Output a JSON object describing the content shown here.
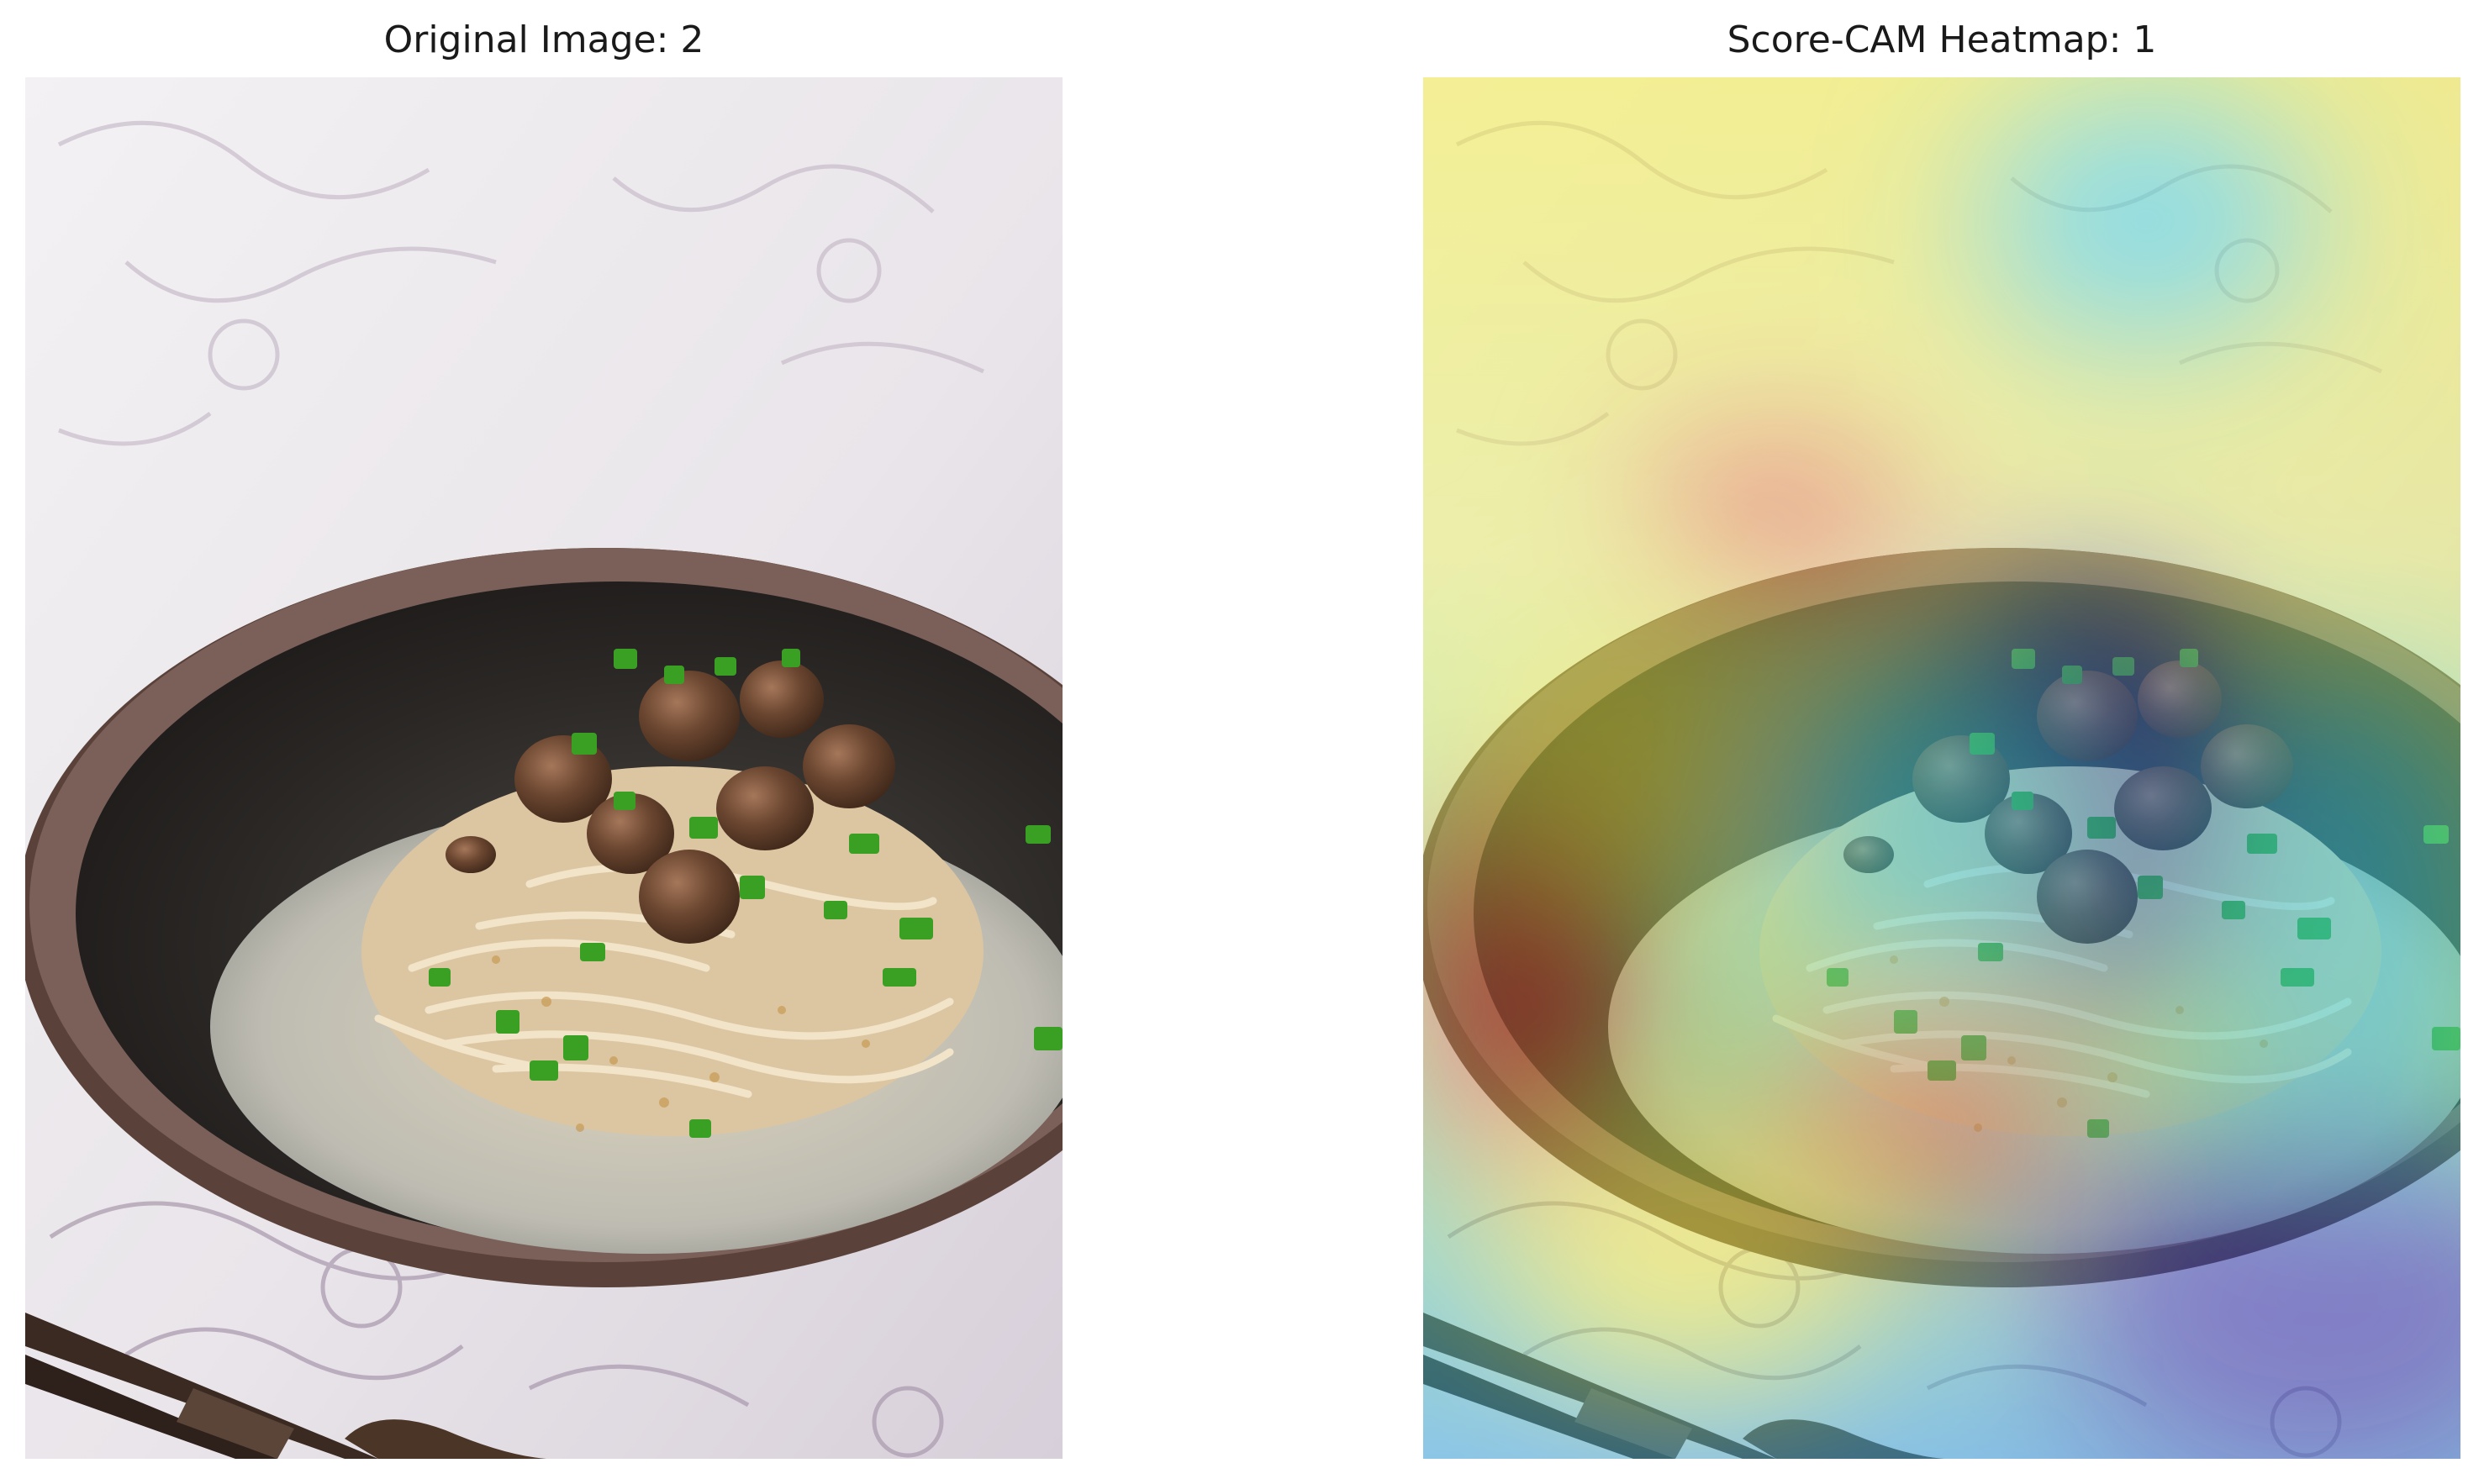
{
  "figure": {
    "left_panel": {
      "title": "Original Image: 2"
    },
    "right_panel": {
      "title": "Score-CAM Heatmap: 1"
    }
  },
  "photo": {
    "watermark_text": "",
    "colors": {
      "tablecloth": "#ebe7ec",
      "tablecloth_pattern": "#b9a9bd",
      "bowl_rim": "#6b5249",
      "bowl_interior": "#2d2a28",
      "broth": "#c7c5b8",
      "noodles": "#e6d3b2",
      "mushroom": "#6b4630",
      "scallion": "#3aa024",
      "chopsticks": "#3b2a22"
    }
  },
  "heatmap": {
    "colormap": "jet",
    "overlay_alpha": 0.5,
    "colors": {
      "low": "#2c2cb0",
      "mid_low": "#2fd0e6",
      "mid": "#7ff07f",
      "mid_high": "#f5ef3a",
      "high": "#e8312a"
    }
  }
}
